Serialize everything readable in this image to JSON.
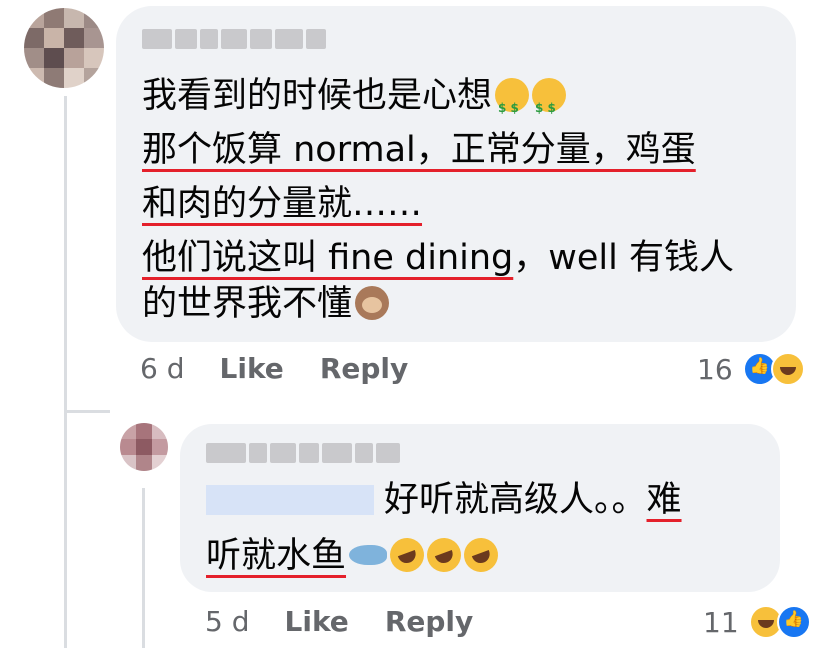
{
  "comments": [
    {
      "author": "",
      "lines": [
        "我看到的时候也是心想",
        "那个饭算 normal，正常分量，鸡蛋",
        "和肉的分量就……",
        "他们说这叫 fine dining",
        "，well 有钱人",
        "的世界我不懂"
      ],
      "emojis_line1": [
        "money-mouth-face-icon",
        "money-mouth-face-icon"
      ],
      "emoji_last": "see-no-evil-monkey-icon",
      "time": "6 d",
      "like_label": "Like",
      "reply_label": "Reply",
      "reaction_count": "16",
      "reactions": [
        "like",
        "haha"
      ]
    },
    {
      "author": "",
      "mention": "",
      "lines": [
        "好听就高级人。。",
        "难",
        "听就水鱼"
      ],
      "emojis": [
        "fish-icon",
        "rolling-laughing-icon",
        "rolling-laughing-icon",
        "rolling-laughing-icon"
      ],
      "time": "5 d",
      "like_label": "Like",
      "reply_label": "Reply",
      "reaction_count": "11",
      "reactions": [
        "haha",
        "like"
      ]
    }
  ],
  "colors": {
    "bubble": "#f0f2f5",
    "underline": "#e4202b",
    "link_blue": "#1877f2",
    "meta": "#65676b"
  }
}
